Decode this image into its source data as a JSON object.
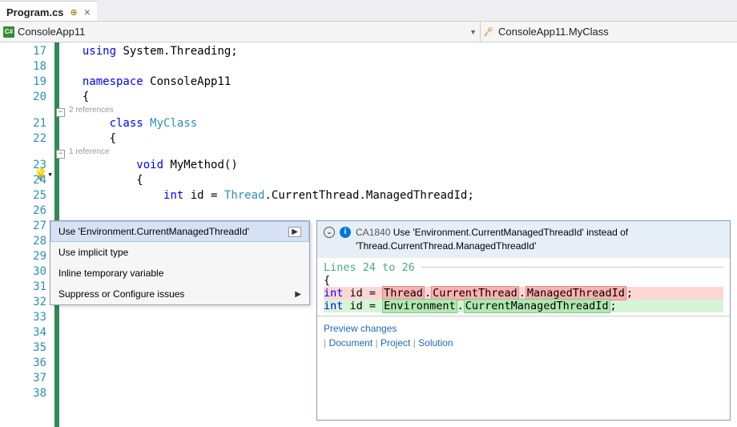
{
  "tab": {
    "title": "Program.cs"
  },
  "nav": {
    "left_icon": "C#",
    "left_text": "ConsoleApp11",
    "right_text": "ConsoleApp11.MyClass"
  },
  "gutter": {
    "start": 17,
    "end": 38
  },
  "codelens": {
    "class_refs": "2 references",
    "method_refs": "1 reference"
  },
  "code": {
    "l17": {
      "kw1": "using",
      "txt1": " System.Threading;"
    },
    "l19": {
      "kw1": "namespace",
      "txt1": " ConsoleApp11"
    },
    "l20": "{",
    "l21": {
      "kw1": "class",
      "type1": "MyClass"
    },
    "l22": "{",
    "l23": {
      "kw1": "void",
      "name": "MyMethod",
      "paren": "()"
    },
    "l24": "{",
    "l25": {
      "kw1": "int",
      "var": " id = ",
      "type1": "Thread",
      "rest": ".CurrentThread.ManagedThreadId;"
    }
  },
  "quick_actions": {
    "items": [
      {
        "label": "Use 'Environment.CurrentManagedThreadId'",
        "has_sub": true,
        "selected": true
      },
      {
        "label": "Use implicit type",
        "has_sub": false
      },
      {
        "label": "Inline temporary variable",
        "has_sub": false
      },
      {
        "label": "Suppress or Configure issues",
        "has_sub": true
      }
    ]
  },
  "preview": {
    "rule_id": "CA1840",
    "rule_msg": "Use 'Environment.CurrentManagedThreadId' instead of 'Thread.CurrentThread.ManagedThreadId'",
    "lines_label": "Lines 24 to 26",
    "open_brace": "{",
    "del": {
      "pre": "    ",
      "kw": "int",
      "mid": " id = ",
      "h1": "Thread",
      "d1": ".",
      "h2": "CurrentThread",
      "d2": ".",
      "h3": "ManagedThreadId",
      "semi": ";"
    },
    "add": {
      "pre": "    ",
      "kw": "int",
      "mid": " id = ",
      "h1": "Environment",
      "d1": ".",
      "h2": "CurrentManagedThreadId",
      "semi": ";"
    },
    "preview_link": "Preview changes",
    "scope": {
      "doc": "Document",
      "proj": "Project",
      "sol": "Solution"
    }
  }
}
